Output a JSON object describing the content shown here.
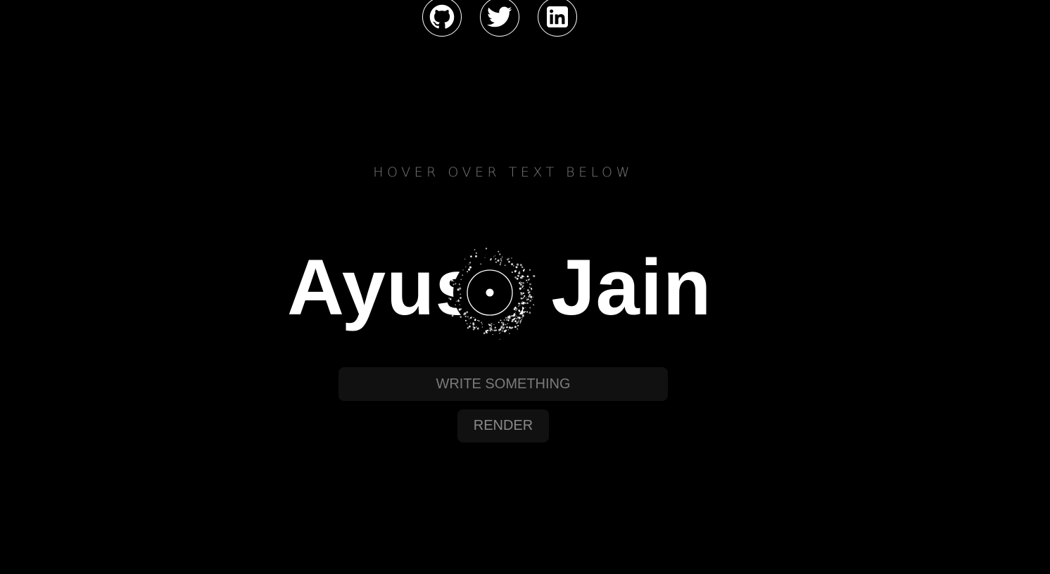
{
  "social": [
    {
      "name": "github-icon"
    },
    {
      "name": "twitter-icon"
    },
    {
      "name": "linkedin-icon"
    }
  ],
  "hint": "HOVER OVER TEXT BELOW",
  "name_text": "Ayush Jain",
  "input": {
    "placeholder": "WRITE SOMETHING",
    "value": ""
  },
  "render_label": "RENDER",
  "colors": {
    "background": "#000000",
    "text": "#ffffff",
    "muted": "#7a7a7a",
    "control_bg": "#111111"
  }
}
